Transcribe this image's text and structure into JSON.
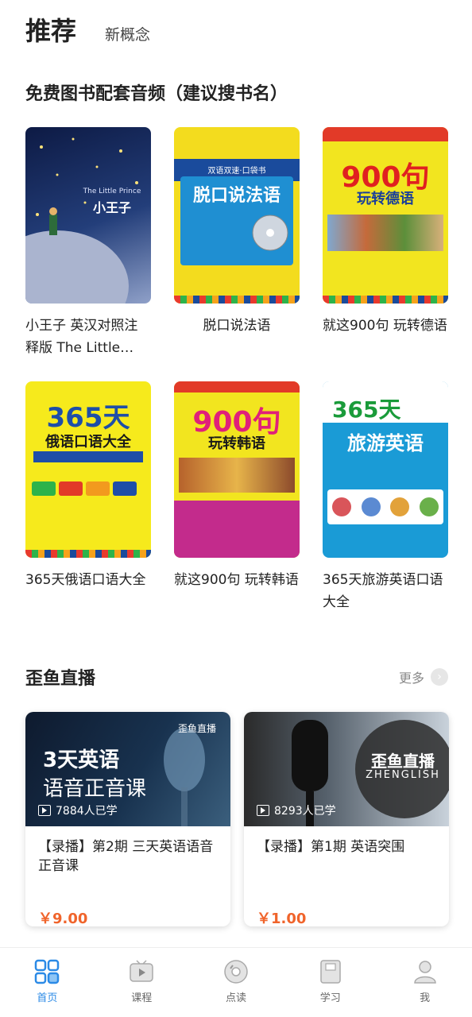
{
  "top_tabs": {
    "active": "推荐",
    "other": "新概念"
  },
  "books_section": {
    "title": "免费图书配套音频（建议搜书名）"
  },
  "books": [
    {
      "title": "小王子 英汉对照注释版 The Little Prince",
      "cover_text": "小王子",
      "cover_sub": "The Little Prince"
    },
    {
      "title": "脱口说法语",
      "cover_text": "脱口说法语",
      "cover_sub": "双语双速·口袋书"
    },
    {
      "title": "就这900句 玩转德语",
      "cover_text": "900句",
      "cover_sub": "玩转德语"
    },
    {
      "title": "365天俄语口语大全",
      "cover_text": "365天",
      "cover_sub": "俄语口语大全"
    },
    {
      "title": "就这900句 玩转韩语",
      "cover_text": "900句",
      "cover_sub": "玩转韩语"
    },
    {
      "title": "365天旅游英语口语大全",
      "cover_text": "365天",
      "cover_sub": "旅游英语"
    }
  ],
  "live": {
    "title": "歪鱼直播",
    "more": "更多",
    "cards": [
      {
        "banner_line1": "3天英语",
        "banner_line2": "语音正音课",
        "brand": "歪鱼直播",
        "views": "7884人已学",
        "title": "【录播】第2期 三天英语语音正音课",
        "price": "￥9.00"
      },
      {
        "banner_line1": "歪鱼直播",
        "banner_line2": "ZHENGLISH",
        "brand": "",
        "views": "8293人已学",
        "title": "【录播】第1期  英语突围",
        "price": "￥1.00"
      }
    ]
  },
  "tabbar": [
    {
      "label": "首页",
      "icon": "home-grid-icon"
    },
    {
      "label": "课程",
      "icon": "tv-play-icon"
    },
    {
      "label": "点读",
      "icon": "disc-icon"
    },
    {
      "label": "学习",
      "icon": "book-icon"
    },
    {
      "label": "我",
      "icon": "user-icon"
    }
  ],
  "colors": {
    "accent": "#2b8ae6",
    "price": "#f0642b"
  }
}
